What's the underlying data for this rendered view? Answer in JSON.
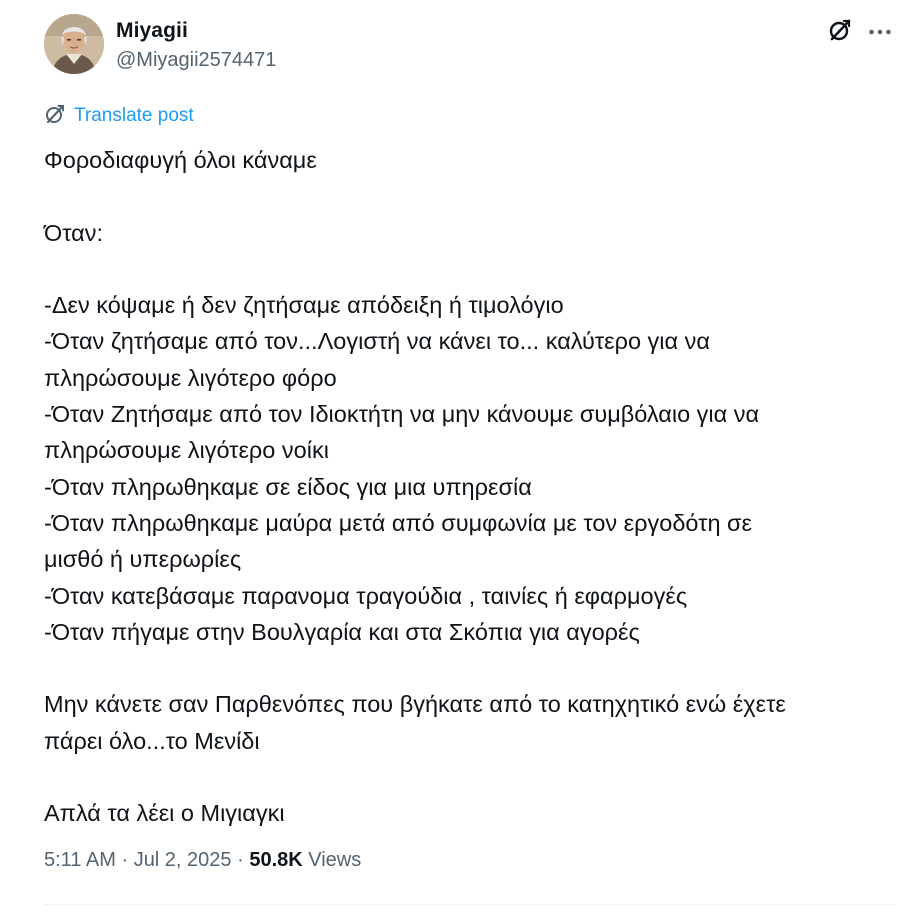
{
  "author": {
    "display_name": "Miyagii",
    "handle": "@Miyagii2574471"
  },
  "translate_label": "Translate post",
  "body_lines": [
    "Φοροδιαφυγή όλοι κάναμε",
    "",
    "Όταν:",
    "",
    "-Δεν κόψαμε ή δεν ζητήσαμε απόδειξη ή τιμολόγιο",
    "-Όταν ζητήσαμε από τον...Λογιστή να κάνει το... καλύτερο για να",
    "πληρώσουμε λιγότερο φόρο",
    "-Όταν Ζητήσαμε από τον Ιδιοκτήτη να μην κάνουμε συμβόλαιο για να",
    "πληρώσουμε λιγότερο νοίκι",
    "-Όταν πληρωθηκαμε σε είδος για μια υπηρεσία",
    "-Όταν πληρωθηκαμε μαύρα μετά από συμφωνία με τον εργοδότη σε",
    "μισθό ή υπερωρίες",
    "-Όταν κατεβάσαμε παρανομα τραγούδια , ταινίες ή εφαρμογές",
    "-Όταν πήγαμε στην Βουλγαρία και στα Σκόπια για αγορές",
    "",
    "Μην κάνετε σαν Παρθενόπες που βγήκατε από το κατηχητικό ενώ έχετε",
    "πάρει όλο...το Μενίδι",
    "",
    "Απλά τα λέει ο Μιγιαγκι"
  ],
  "meta": {
    "time": "5:11 AM",
    "sep1": " · ",
    "date": "Jul 2, 2025",
    "sep2": " · ",
    "views_count": "50.8K",
    "views_label": " Views"
  },
  "icons": {
    "grok": "grok-icon",
    "more": "more-icon",
    "translate": "translate-icon"
  },
  "colors": {
    "text": "#0f1419",
    "secondary": "#536471",
    "link": "#1d9bf0",
    "divider": "#eff3f4"
  }
}
